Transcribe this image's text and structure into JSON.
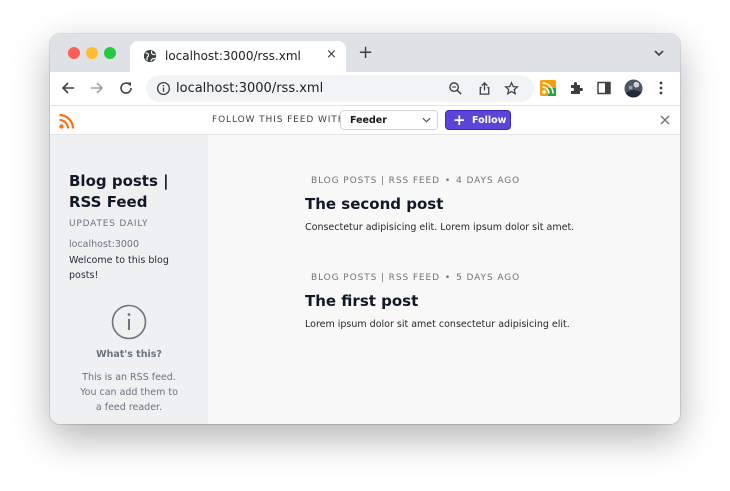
{
  "browser": {
    "tab": {
      "title": "localhost:3000/rss.xml",
      "close_label": "×"
    },
    "new_tab_label": "+",
    "address": {
      "url": "localhost:3000/rss.xml"
    }
  },
  "feed_banner": {
    "follow_label": "FOLLOW THIS FEED WITH",
    "reader_selected": "Feeder",
    "follow_button_label": "Follow",
    "follow_button_icon": "+",
    "accent_color": "#5b45d6"
  },
  "sidebar": {
    "title": "Blog posts | RSS Feed",
    "updates": "UPDATES DAILY",
    "host": "localhost:3000",
    "description": "Welcome to this blog posts!",
    "whats_this_title": "What's this?",
    "whats_this_text": "This is an RSS feed. You can add them to a feed reader."
  },
  "posts": [
    {
      "source": "BLOG POSTS | RSS FEED",
      "age": "4 DAYS AGO",
      "title": "The second post",
      "excerpt": "Consectetur adipisicing elit. Lorem ipsum dolor sit amet."
    },
    {
      "source": "BLOG POSTS | RSS FEED",
      "age": "5 DAYS AGO",
      "title": "The first post",
      "excerpt": "Lorem ipsum dolor sit amet consectetur adipisicing elit."
    }
  ]
}
